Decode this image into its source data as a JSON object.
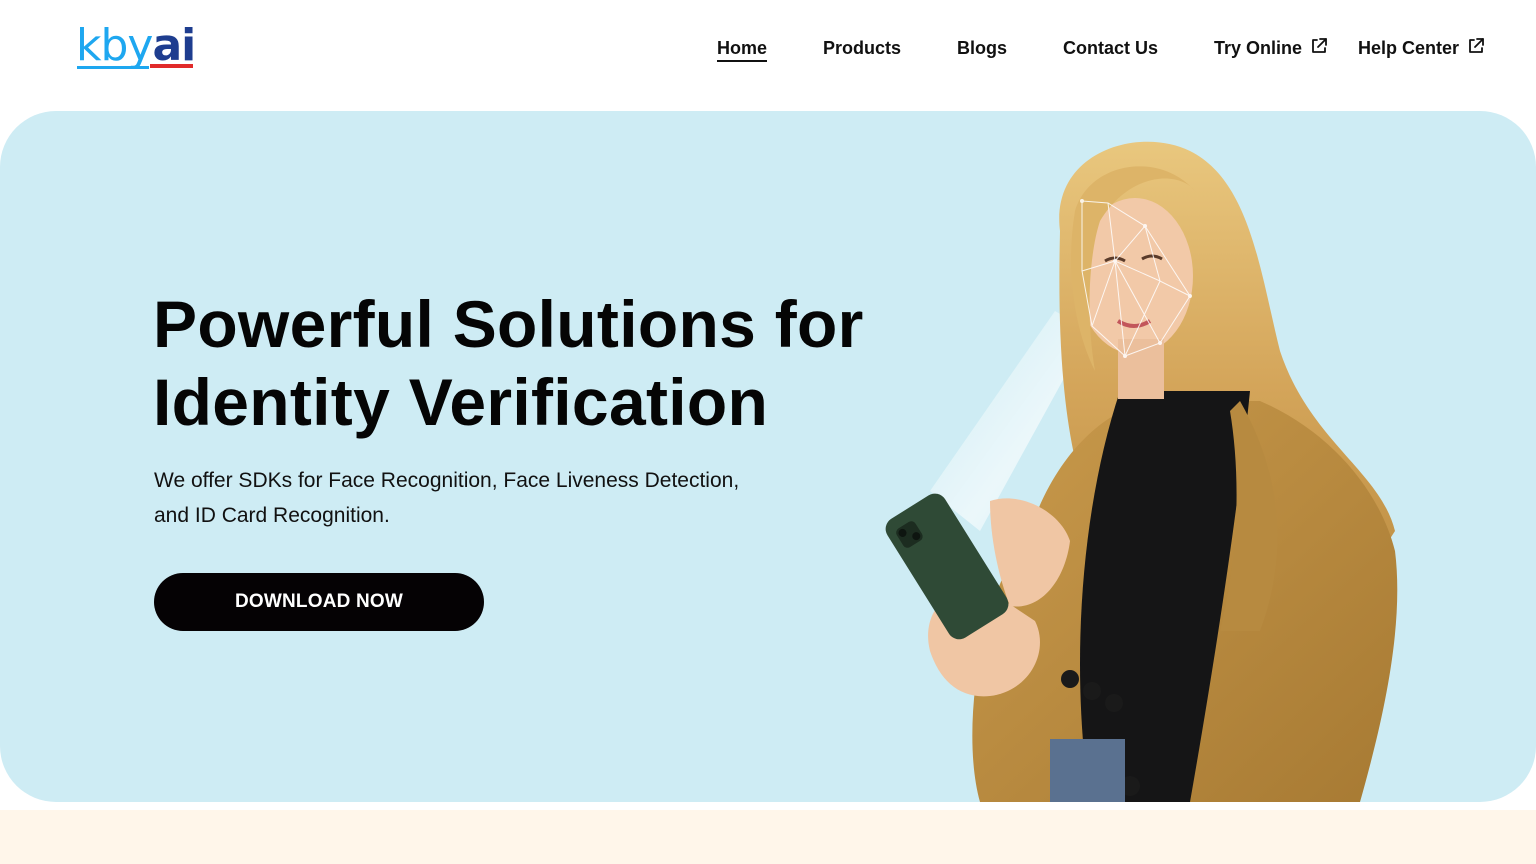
{
  "brand": {
    "logo_kby": "kby",
    "logo_ai": "ai",
    "colors": {
      "blue": "#1ea7f0",
      "navy": "#1e3d8f",
      "red": "#e12a2a"
    }
  },
  "nav": {
    "items": [
      {
        "label": "Home",
        "active": true,
        "external": false
      },
      {
        "label": "Products",
        "active": false,
        "external": false
      },
      {
        "label": "Blogs",
        "active": false,
        "external": false
      },
      {
        "label": "Contact Us",
        "active": false,
        "external": false
      },
      {
        "label": "Try Online",
        "active": false,
        "external": true,
        "icon": "external-link-icon"
      },
      {
        "label": "Help Center",
        "active": false,
        "external": true,
        "icon": "external-link-icon"
      }
    ]
  },
  "hero": {
    "title_line1": "Powerful Solutions for",
    "title_line2": "Identity Verification",
    "subtitle_line1": "We offer SDKs for Face Recognition, Face Liveness Detection,",
    "subtitle_line2": "and ID Card Recognition.",
    "cta_label": "DOWNLOAD NOW",
    "background": "#ceecf4"
  },
  "footer_band": {
    "background": "#fff6ea"
  }
}
